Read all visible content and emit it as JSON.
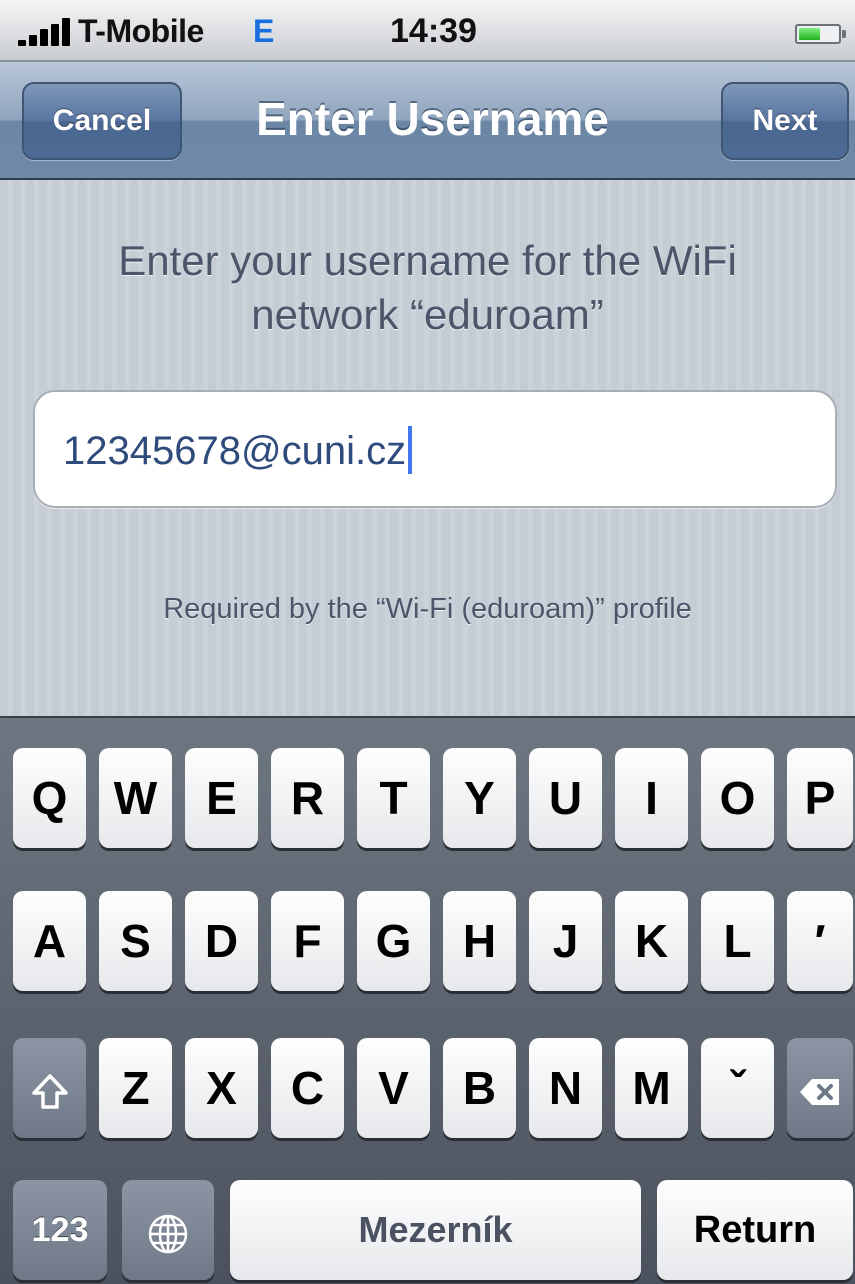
{
  "status_bar": {
    "carrier": "T-Mobile",
    "network_type": "E",
    "time": "14:39",
    "signal_bars": 5,
    "battery_level": 0.55
  },
  "nav_bar": {
    "title": "Enter Username",
    "left_button": "Cancel",
    "right_button": "Next"
  },
  "form": {
    "instruction": "Enter your username for the WiFi network “eduroam”",
    "username_value": "12345678@cuni.cz",
    "footnote": "Required by the “Wi-Fi (eduroam)” profile"
  },
  "keyboard": {
    "row1": [
      "Q",
      "W",
      "E",
      "R",
      "T",
      "Y",
      "U",
      "I",
      "O",
      "P"
    ],
    "row2": [
      "A",
      "S",
      "D",
      "F",
      "G",
      "H",
      "J",
      "K",
      "L",
      "′"
    ],
    "row3": [
      "Z",
      "X",
      "C",
      "V",
      "B",
      "N",
      "M",
      "ˇ"
    ],
    "numbers_key": "123",
    "space_key": "Mezerník",
    "return_key": "Return",
    "shift_icon": "shift-arrow-icon",
    "globe_icon": "globe-icon",
    "backspace_icon": "backspace-icon"
  },
  "colors": {
    "nav_bar": "#6f89a9",
    "link_text": "#2f4b7c",
    "network_type": "#1a6fe0",
    "caret": "#4178ee"
  }
}
